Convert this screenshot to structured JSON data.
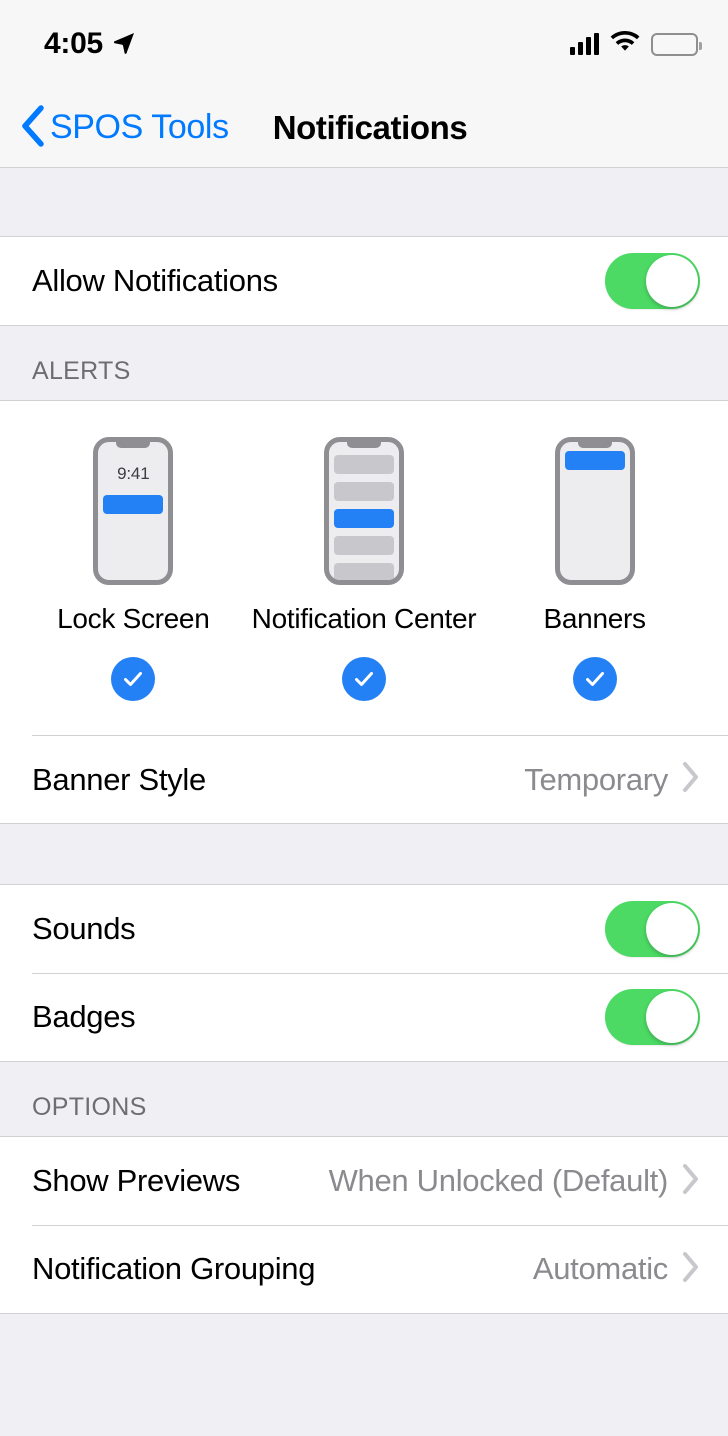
{
  "status_bar": {
    "time": "4:05",
    "location_icon": "location-arrow-icon",
    "signal_icon": "cellular-signal-icon",
    "signal_bars": 4,
    "wifi_icon": "wifi-icon",
    "battery_icon": "battery-full-icon"
  },
  "nav": {
    "back_label": "SPOS Tools",
    "back_icon": "chevron-left-icon",
    "title": "Notifications"
  },
  "allow_section": {
    "rows": [
      {
        "label": "Allow Notifications",
        "toggle": true
      }
    ]
  },
  "alerts_section": {
    "header": "ALERTS",
    "previews": [
      {
        "label": "Lock Screen",
        "checked": true,
        "phone_time": "9:41",
        "style": "lock"
      },
      {
        "label": "Notification Center",
        "checked": true,
        "phone_time": "",
        "style": "center"
      },
      {
        "label": "Banners",
        "checked": true,
        "phone_time": "",
        "style": "banner"
      }
    ],
    "banner_style": {
      "label": "Banner Style",
      "value": "Temporary",
      "chevron": "chevron-right-icon"
    }
  },
  "sounds_section": {
    "rows": [
      {
        "label": "Sounds",
        "toggle": true
      },
      {
        "label": "Badges",
        "toggle": true
      }
    ]
  },
  "options_section": {
    "header": "OPTIONS",
    "rows": [
      {
        "label": "Show Previews",
        "value": "When Unlocked (Default)",
        "chevron": "chevron-right-icon"
      },
      {
        "label": "Notification Grouping",
        "value": "Automatic",
        "chevron": "chevron-right-icon"
      }
    ]
  },
  "colors": {
    "accent_blue": "#007AFF",
    "preview_blue": "#2481F5",
    "toggle_green": "#4CD964",
    "group_background": "#EFEFF4",
    "row_background": "#FFFFFF",
    "separator": "#D2D2D6",
    "secondary_text": "#8A8A8F",
    "header_text": "#6D6D72"
  }
}
